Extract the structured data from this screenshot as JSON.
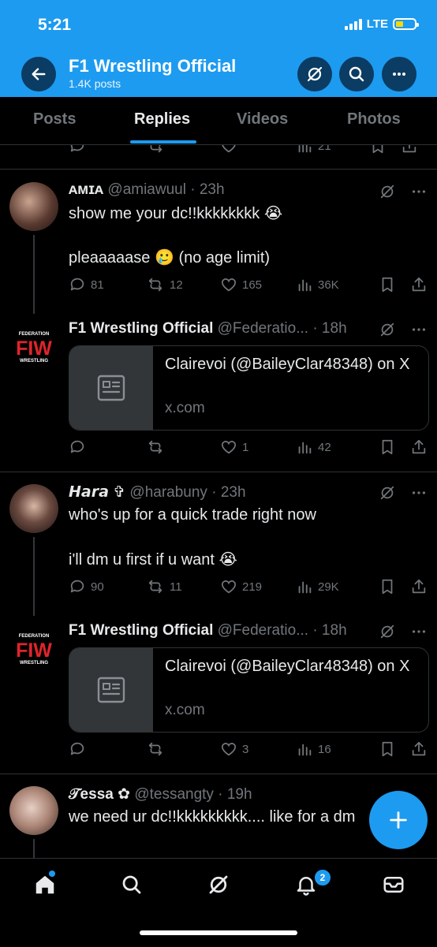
{
  "status": {
    "time": "5:21",
    "network": "LTE"
  },
  "header": {
    "title": "F1 Wrestling Official",
    "posts_count": "1.4K posts"
  },
  "tabs": [
    {
      "label": "Posts"
    },
    {
      "label": "Replies"
    },
    {
      "label": "Videos"
    },
    {
      "label": "Photos"
    }
  ],
  "partial_row": {
    "views": "21"
  },
  "posts": [
    {
      "name": "ᴀᴍɪᴀ",
      "handle": "@amiawuul",
      "time": "· 23h",
      "line1": "show me your dc!!kkkkkkkk 😭",
      "line2": "pleaaaaase 🥲  (no age limit)",
      "replies": "81",
      "reposts": "12",
      "likes": "165",
      "views": "36K"
    },
    {
      "name": "F1 Wrestling Official",
      "handle": "@Federatio...",
      "time": "· 18h",
      "card_title": "Clairevoi (@BaileyClar48348) on X",
      "card_domain": "x.com",
      "replies": "",
      "reposts": "",
      "likes": "1",
      "views": "42"
    },
    {
      "name": "𝙃𝙖𝙧𝙖 ✞",
      "handle": "@harabuny",
      "time": "· 23h",
      "line1": "who's up for a quick trade right now",
      "line2": "i'll dm u first if u want 😭",
      "replies": "90",
      "reposts": "11",
      "likes": "219",
      "views": "29K"
    },
    {
      "name": "F1 Wrestling Official",
      "handle": "@Federatio...",
      "time": "· 18h",
      "card_title": "Clairevoi (@BaileyClar48348) on X",
      "card_domain": "x.com",
      "replies": "",
      "reposts": "",
      "likes": "3",
      "views": "16"
    },
    {
      "name": "𝒯essa ✿",
      "handle": "@tessangty",
      "time": "· 19h",
      "line1": "we need ur dc!!kkkkkkkkk.... like for a dm"
    }
  ],
  "logo": {
    "top": "FEDERATION",
    "mid": "FIW",
    "bottom": "WRESTLING"
  },
  "notifications_badge": "2",
  "colors": {
    "accent": "#1d9bf0",
    "background": "#000000",
    "muted": "#71767b"
  }
}
